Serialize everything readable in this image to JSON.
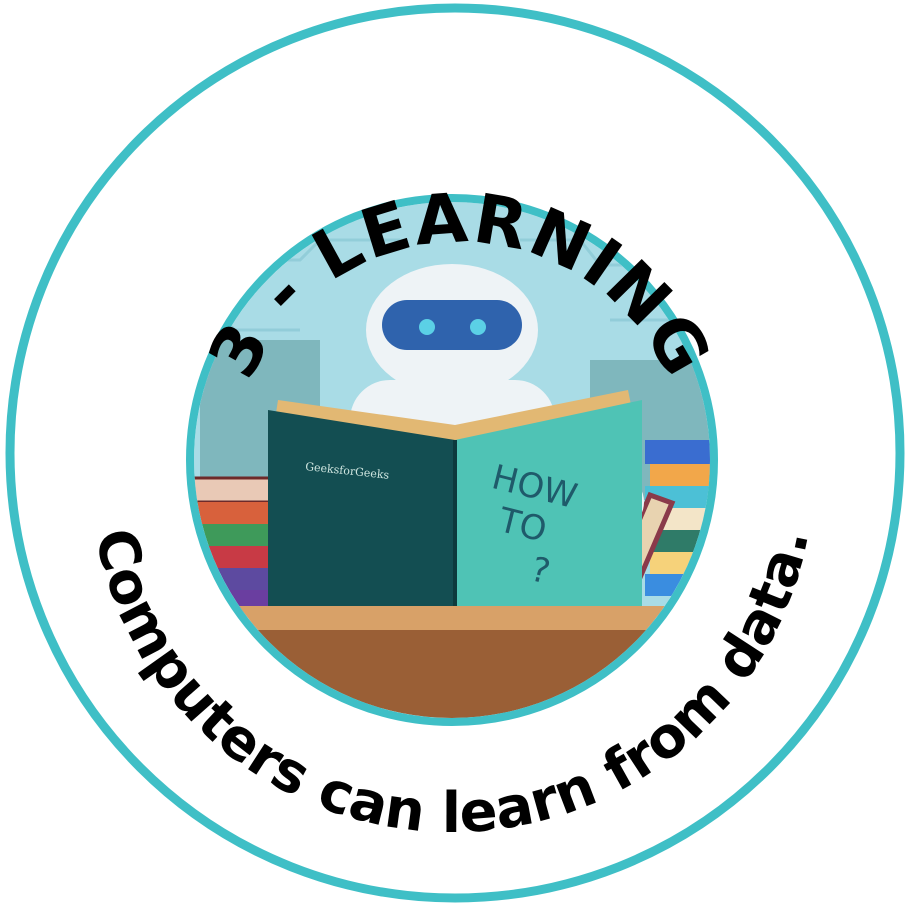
{
  "badge": {
    "title": "3 - LEARNING",
    "caption": "Computers can learn from data.",
    "colors": {
      "ring": "#3fbfc6",
      "sky": "#a9dce6",
      "robot_face": "#2f63ad",
      "robot_eyes": "#5bd0e6",
      "book_cover_left": "#134e52",
      "book_cover_right": "#4fc3b5",
      "desk": "#9a5f36",
      "text": "#000000"
    }
  },
  "illustration": {
    "subject": "robot reading book",
    "book_logo": "GeeksforGeeks",
    "book_text": {
      "line1": "HOW",
      "line2": "TO",
      "line3": "?"
    }
  }
}
